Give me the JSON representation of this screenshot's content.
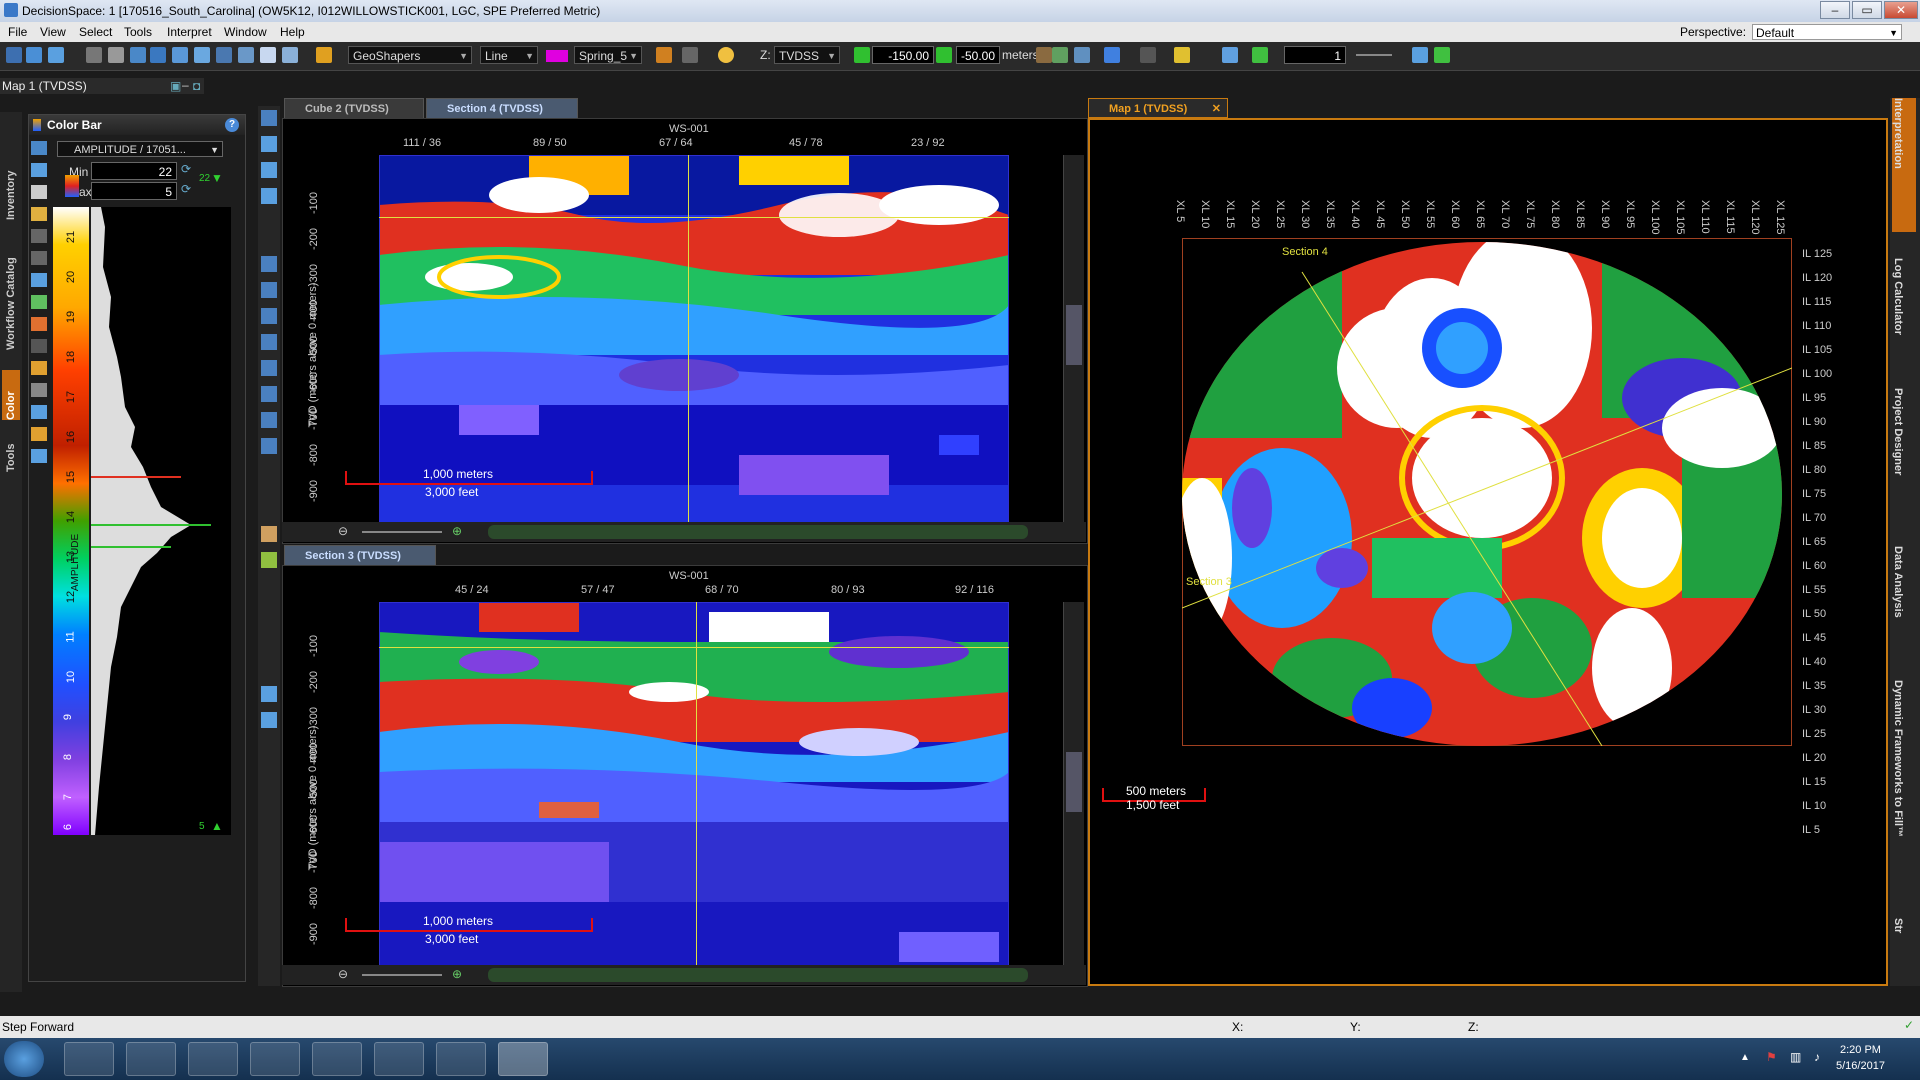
{
  "window": {
    "title": "DecisionSpace: 1 [170516_South_Carolina] (OW5K12, I012WILLOWSTICK001, LGC, SPE Preferred Metric)",
    "minimize": "–",
    "maximize": "▭",
    "close": "✕"
  },
  "menu": [
    "File",
    "View",
    "Select",
    "Tools",
    "Interpret",
    "Window",
    "Help"
  ],
  "perspective": {
    "label": "Perspective:",
    "value": "Default"
  },
  "toolbar": {
    "geoshapers": "GeoShapers",
    "line_style": "Line",
    "color_scheme": "Spring_5",
    "z_label": "Z:",
    "z_domain": "TVDSS",
    "z_min": "-150.00",
    "z_max": "-50.00",
    "z_unit": "meters",
    "count": "1"
  },
  "left": {
    "title": "Map 1 (TVDSS)",
    "vtabs": [
      "Inventory",
      "Workflow Catalog",
      "Color",
      "Tools"
    ],
    "colorbar": {
      "header": "Color Bar",
      "attribute": "AMPLITUDE / 17051...",
      "min_label": "Min",
      "min_value": "22",
      "max_label": "Max",
      "max_value": "5",
      "scale_labels": [
        "21",
        "20",
        "19",
        "18",
        "17",
        "16",
        "15",
        "14",
        "13",
        "12",
        "11",
        "10",
        "9",
        "8",
        "7",
        "6"
      ],
      "top_value": "22",
      "bottom_value": "5",
      "axis_title": "AMPLITUDE"
    }
  },
  "tabs": {
    "cube2": "Cube 2 (TVDSS)",
    "section4": "Section 4 (TVDSS)",
    "section3": "Section 3 (TVDSS)",
    "map1": "Map 1 (TVDSS)"
  },
  "section4": {
    "well": "WS-001",
    "top_ticks": [
      "111 / 36",
      "89 / 50",
      "67 / 64",
      "45 / 78",
      "23 / 92"
    ],
    "ylabel": "TVD (meters above 0 meters)",
    "depths": [
      "-100",
      "-200",
      "-300",
      "-400",
      "-500",
      "-600",
      "-700",
      "-800",
      "-900"
    ],
    "scale_m": "1,000 meters",
    "scale_ft": "3,000 feet"
  },
  "section3": {
    "well": "WS-001",
    "top_ticks": [
      "45 / 24",
      "57 / 47",
      "68 / 70",
      "80 / 93",
      "92 / 116"
    ],
    "ylabel": "TVD (meters above 0 meters)",
    "depths": [
      "-100",
      "-200",
      "-300",
      "-400",
      "-500",
      "-600",
      "-700",
      "-800",
      "-900"
    ],
    "scale_m": "1,000 meters",
    "scale_ft": "3,000 feet"
  },
  "map1": {
    "xl_labels": [
      "XL 5",
      "XL 10",
      "XL 15",
      "XL 20",
      "XL 25",
      "XL 30",
      "XL 35",
      "XL 40",
      "XL 45",
      "XL 50",
      "XL 55",
      "XL 60",
      "XL 65",
      "XL 70",
      "XL 75",
      "XL 80",
      "XL 85",
      "XL 90",
      "XL 95",
      "XL 100",
      "XL 105",
      "XL 110",
      "XL 115",
      "XL 120",
      "XL 125"
    ],
    "il_labels": [
      "IL 125",
      "IL 120",
      "IL 115",
      "IL 110",
      "IL 105",
      "IL 100",
      "IL 95",
      "IL 90",
      "IL 85",
      "IL 80",
      "IL 75",
      "IL 70",
      "IL 65",
      "IL 60",
      "IL 55",
      "IL 50",
      "IL 45",
      "IL 40",
      "IL 35",
      "IL 30",
      "IL 25",
      "IL 20",
      "IL 15",
      "IL 10",
      "IL 5"
    ],
    "section4_label": "Section 4",
    "section3_label": "Section 3",
    "scale_m": "500 meters",
    "scale_ft": "1,500 feet"
  },
  "right_tabs": [
    "Interpretation",
    "Log Calculator",
    "Project Designer",
    "Data Analysis",
    "Dynamic Frameworks to Fill™",
    "Str"
  ],
  "status": {
    "text": "Step Forward",
    "x": "X:",
    "y": "Y:",
    "z": "Z:"
  },
  "taskbar": {
    "time": "2:20 PM",
    "date": "5/16/2017"
  }
}
